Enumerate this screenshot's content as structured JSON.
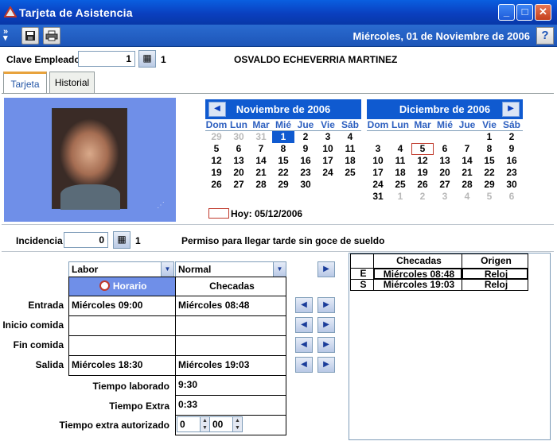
{
  "window": {
    "title": "Tarjeta de Asistencia",
    "min": "_",
    "max": "□",
    "close": "✕"
  },
  "toolbar": {
    "date": "Miércoles, 01 de Noviembre de 2006",
    "help": "?"
  },
  "employee": {
    "label": "Clave Empleado",
    "value": "1",
    "code": "1",
    "name": "OSVALDO ECHEVERRIA MARTINEZ"
  },
  "tabs": [
    "Tarjeta",
    "Historial"
  ],
  "calendar": {
    "dow": [
      "Dom",
      "Lun",
      "Mar",
      "Mié",
      "Jue",
      "Vie",
      "Sáb"
    ],
    "months": [
      {
        "title": "Noviembre de 2006",
        "weeks": [
          [
            "29",
            "30",
            "31",
            "1",
            "2",
            "3",
            "4"
          ],
          [
            "5",
            "6",
            "7",
            "8",
            "9",
            "10",
            "11"
          ],
          [
            "12",
            "13",
            "14",
            "15",
            "16",
            "17",
            "18"
          ],
          [
            "19",
            "20",
            "21",
            "22",
            "23",
            "24",
            "25"
          ],
          [
            "26",
            "27",
            "28",
            "29",
            "30",
            "",
            ""
          ]
        ]
      },
      {
        "title": "Diciembre de 2006",
        "weeks": [
          [
            "",
            "",
            "",
            "",
            "",
            "1",
            "2"
          ],
          [
            "3",
            "4",
            "5",
            "6",
            "7",
            "8",
            "9"
          ],
          [
            "10",
            "11",
            "12",
            "13",
            "14",
            "15",
            "16"
          ],
          [
            "17",
            "18",
            "19",
            "20",
            "21",
            "22",
            "23"
          ],
          [
            "24",
            "25",
            "26",
            "27",
            "28",
            "29",
            "30"
          ],
          [
            "31",
            "1",
            "2",
            "3",
            "4",
            "5",
            "6"
          ]
        ]
      }
    ],
    "today_label": "Hoy: 05/12/2006"
  },
  "incidence": {
    "label": "Incidencia",
    "value": "0",
    "code": "1",
    "description": "Permiso para llegar tarde sin goce de sueldo"
  },
  "schedule": {
    "select_left": "Labor",
    "select_right": "Normal",
    "col_horario": "Horario",
    "col_checadas": "Checadas",
    "rows": [
      {
        "label": "Entrada",
        "horario": "Miércoles 09:00",
        "checadas": "Miércoles 08:48"
      },
      {
        "label": "Inicio comida",
        "horario": "",
        "checadas": ""
      },
      {
        "label": "Fin comida",
        "horario": "",
        "checadas": ""
      },
      {
        "label": "Salida",
        "horario": "Miércoles 18:30",
        "checadas": "Miércoles 19:03"
      }
    ],
    "tiempo_laborado_label": "Tiempo laborado",
    "tiempo_laborado": "9:30",
    "tiempo_extra_label": "Tiempo Extra",
    "tiempo_extra": "0:33",
    "tiempo_autorizado_label": "Tiempo extra autorizado",
    "auth_hours": "0",
    "auth_minutes": "00"
  },
  "checks": {
    "headers": [
      "Checadas",
      "Origen"
    ],
    "rows": [
      {
        "type": "E",
        "when": "Miércoles 08:48",
        "origin": "Reloj"
      },
      {
        "type": "S",
        "when": "Miércoles 19:03",
        "origin": "Reloj"
      }
    ]
  }
}
